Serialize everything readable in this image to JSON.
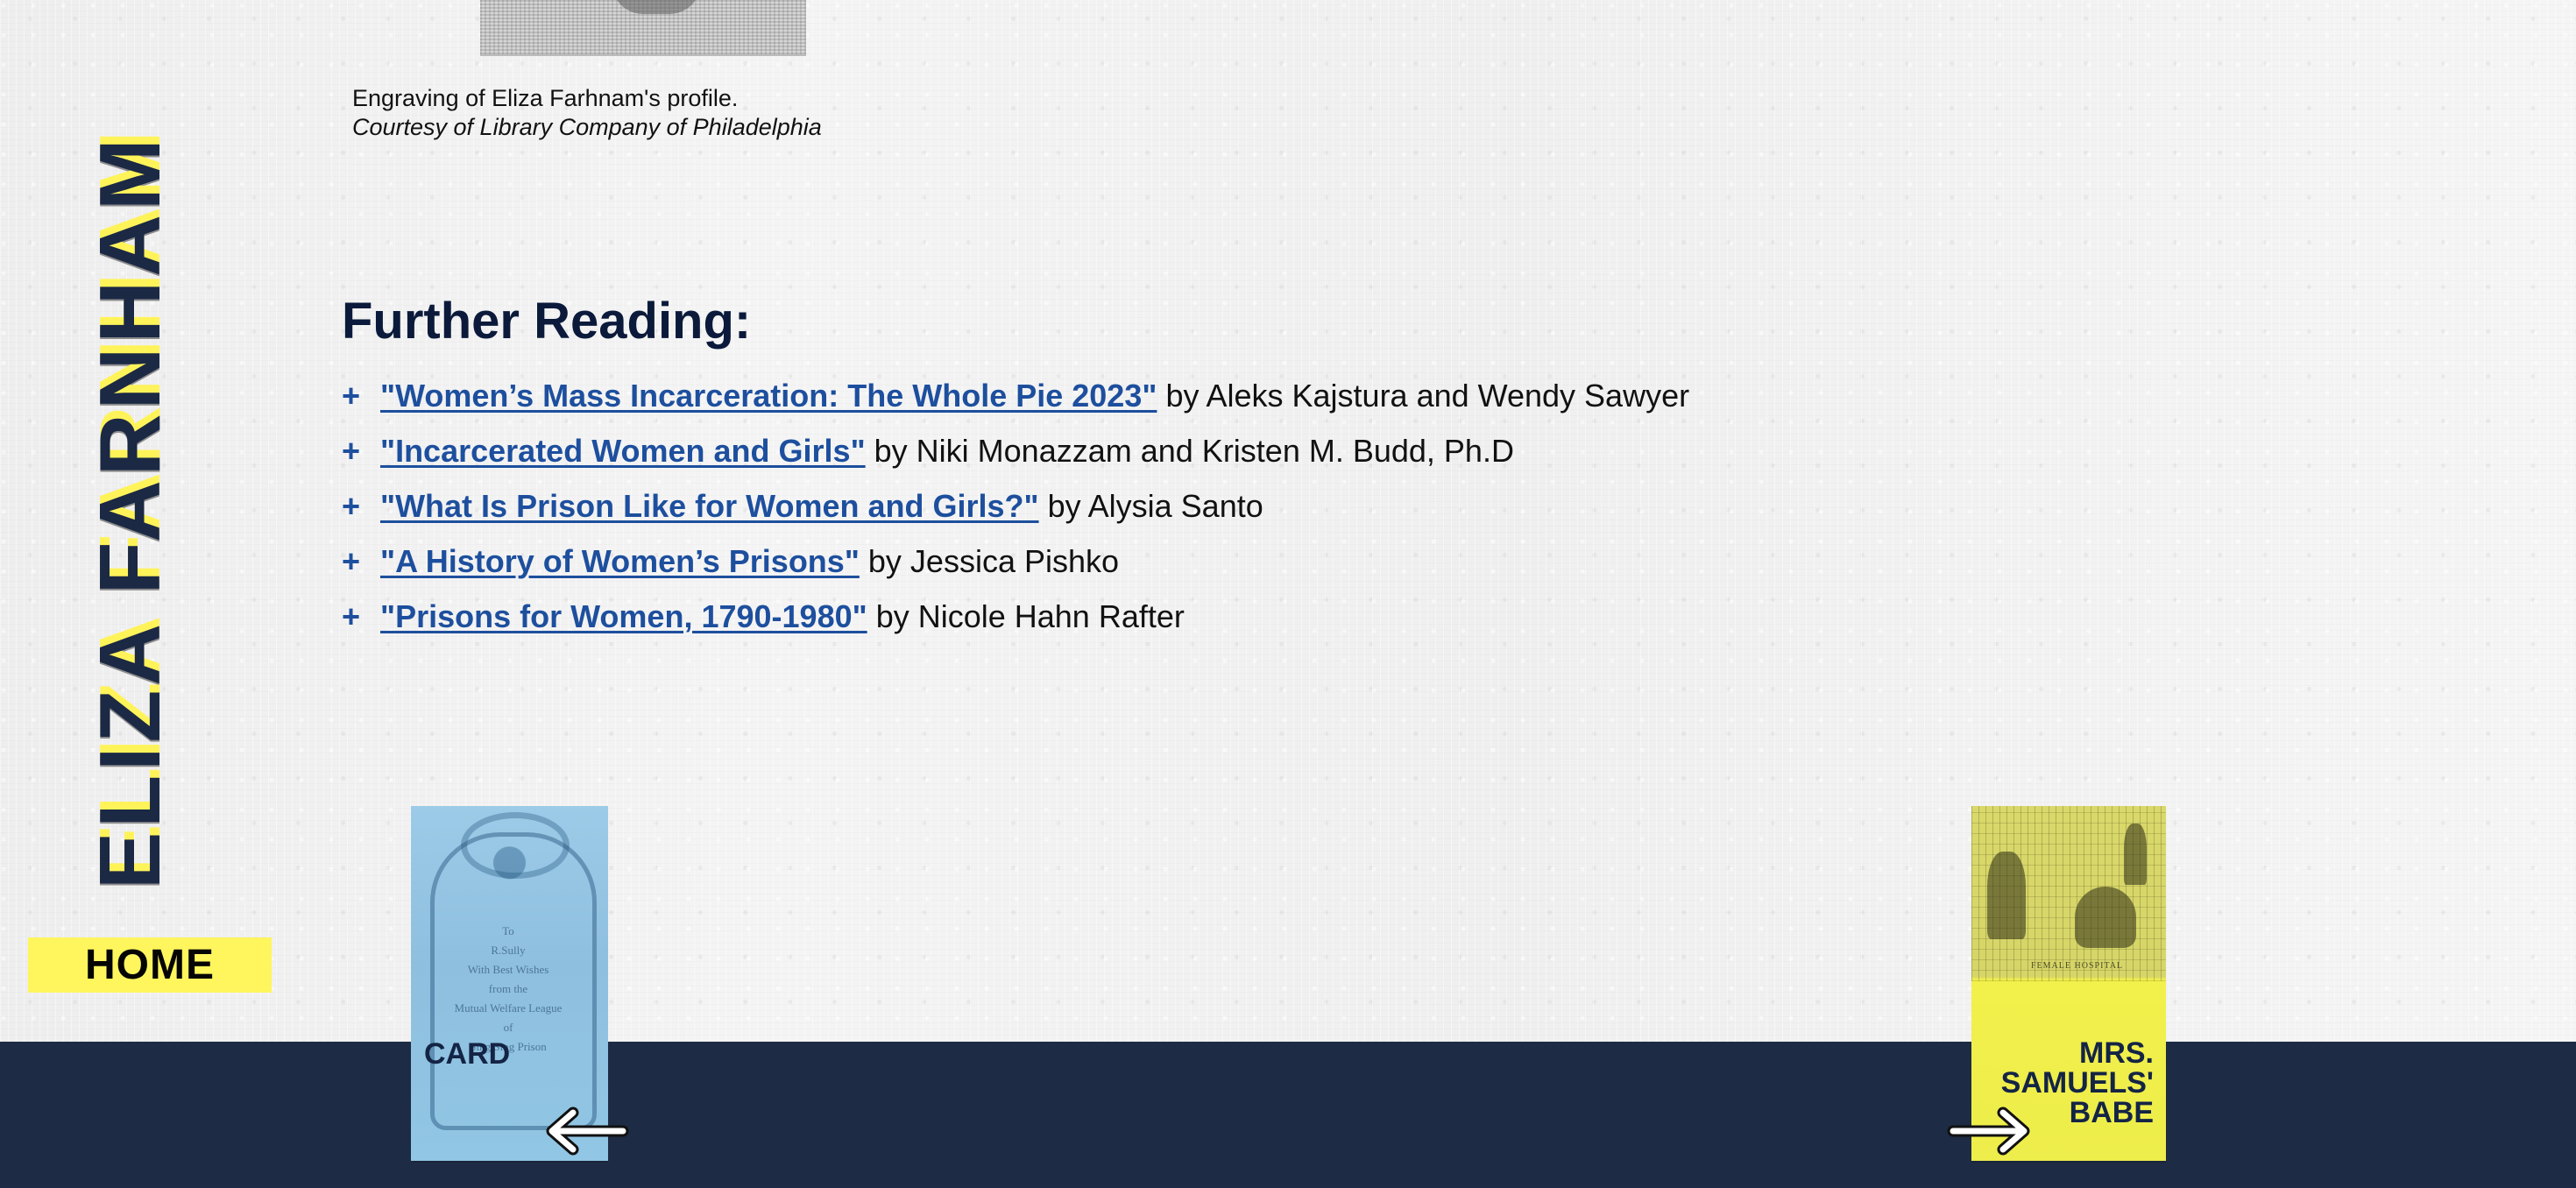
{
  "site": {
    "side_title": "ELIZA FARNHAM",
    "home_label": "HOME"
  },
  "image_caption": {
    "line1": "Engraving of Eliza Farhnam's profile.",
    "line2": "Courtesy of Library Company of Philadelphia"
  },
  "further_reading": {
    "title": "Further Reading:",
    "items": [
      {
        "marker": "+",
        "link_text": "\"Women’s Mass Incarceration: The Whole Pie 2023\"",
        "author_text": "by Aleks Kajstura and Wendy Sawyer"
      },
      {
        "marker": "+",
        "link_text": "\"Incarcerated Women and Girls\"",
        "author_text": "by Niki Monazzam and Kristen M. Budd, Ph.D"
      },
      {
        "marker": "+",
        "link_text": "\"What Is Prison Like for Women and Girls?\"",
        "author_text": "by Alysia Santo"
      },
      {
        "marker": "+",
        "link_text": "\"A History of Women’s Prisons\"",
        "author_text": "by Jessica Pishko"
      },
      {
        "marker": "+",
        "link_text": "\"Prisons for Women, 1790-1980\"",
        "author_text": "by Nicole Hahn Rafter"
      }
    ]
  },
  "navigation": {
    "previous_card": {
      "label": "CARD",
      "icon": "arrow-left-icon",
      "ornament_text": "To\nR.Sully\nWith Best Wishes\nfrom the\nMutual Welfare League\nof\nSing Sing Prison"
    },
    "next_card": {
      "label": "MRS. SAMUELS' BABE",
      "icon": "arrow-right-icon",
      "scene_caption": "FEMALE HOSPITAL"
    }
  },
  "colors": {
    "navy": "#1d2b44",
    "yellow": "#fff55d",
    "link_blue": "#1d4f9e"
  }
}
